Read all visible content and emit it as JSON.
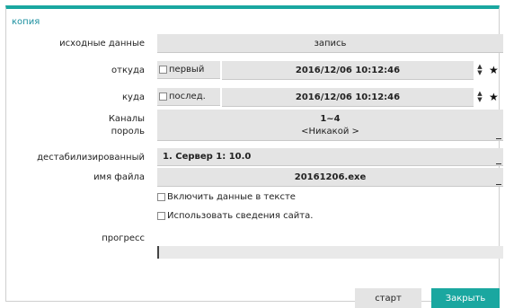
{
  "dialog": {
    "title": "копия"
  },
  "labels": {
    "source": "исходные данные",
    "from": "откуда",
    "to": "куда",
    "channels": "Каналы",
    "password": "пороль",
    "destination": "дестабилизированный",
    "filename": "имя файла",
    "progress": "прогресс"
  },
  "fields": {
    "source": "запись",
    "from_checkbox": "первый",
    "from_datetime": "2016/12/06  10:12:46",
    "to_checkbox": "послед.",
    "to_datetime": "2016/12/06  10:12:46",
    "channels": "1~4",
    "password": "<Никакой >",
    "destination": "1. Сервер 1: 10.0",
    "filename": "20161206.exe"
  },
  "options": {
    "include_text": "Включить данные в тексте",
    "use_site_info": "Использовать сведения сайта."
  },
  "progress": {
    "value": 0
  },
  "buttons": {
    "start": "старт",
    "close": "Закрыть"
  },
  "icons": {
    "spinner": "spinner-up-down-icon",
    "star": "star-icon"
  },
  "colors": {
    "accent": "#1aa7a0",
    "field_bg": "#e4e4e4"
  }
}
